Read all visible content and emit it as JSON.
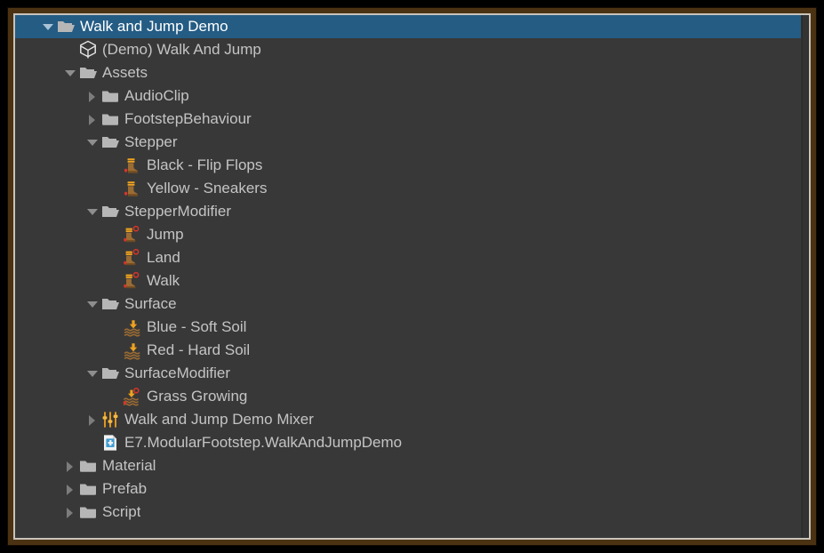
{
  "window": {
    "frame_color": "#4a3212",
    "panel_background": "#383838",
    "selection_color": "#245c84",
    "text_color": "#c4c4c4",
    "selected_text_color": "#ffffff"
  },
  "tree": {
    "rows": [
      {
        "label": "Walk and Jump Demo",
        "depth": 0,
        "twisty": "down",
        "icon": "folder-open-icon",
        "selected": true
      },
      {
        "label": "(Demo) Walk And Jump",
        "depth": 1,
        "twisty": "none",
        "icon": "unity-scene-icon",
        "selected": false
      },
      {
        "label": "Assets",
        "depth": 1,
        "twisty": "down",
        "icon": "folder-open-icon",
        "selected": false
      },
      {
        "label": "AudioClip",
        "depth": 2,
        "twisty": "right",
        "icon": "folder-closed-icon",
        "selected": false
      },
      {
        "label": "FootstepBehaviour",
        "depth": 2,
        "twisty": "right",
        "icon": "folder-closed-icon",
        "selected": false
      },
      {
        "label": "Stepper",
        "depth": 2,
        "twisty": "down",
        "icon": "folder-open-icon",
        "selected": false
      },
      {
        "label": "Black - Flip Flops",
        "depth": 3,
        "twisty": "none",
        "icon": "stepper-boot-icon",
        "selected": false
      },
      {
        "label": "Yellow - Sneakers",
        "depth": 3,
        "twisty": "none",
        "icon": "stepper-boot-icon",
        "selected": false
      },
      {
        "label": "StepperModifier",
        "depth": 2,
        "twisty": "down",
        "icon": "folder-open-icon",
        "selected": false
      },
      {
        "label": "Jump",
        "depth": 3,
        "twisty": "none",
        "icon": "stepper-modifier-icon",
        "selected": false
      },
      {
        "label": "Land",
        "depth": 3,
        "twisty": "none",
        "icon": "stepper-modifier-icon",
        "selected": false
      },
      {
        "label": "Walk",
        "depth": 3,
        "twisty": "none",
        "icon": "stepper-modifier-icon",
        "selected": false
      },
      {
        "label": "Surface",
        "depth": 2,
        "twisty": "down",
        "icon": "folder-open-icon",
        "selected": false
      },
      {
        "label": "Blue - Soft Soil",
        "depth": 3,
        "twisty": "none",
        "icon": "surface-icon",
        "selected": false
      },
      {
        "label": "Red - Hard Soil",
        "depth": 3,
        "twisty": "none",
        "icon": "surface-icon",
        "selected": false
      },
      {
        "label": "SurfaceModifier",
        "depth": 2,
        "twisty": "down",
        "icon": "folder-open-icon",
        "selected": false
      },
      {
        "label": "Grass Growing",
        "depth": 3,
        "twisty": "none",
        "icon": "surface-modifier-icon",
        "selected": false
      },
      {
        "label": "Walk and Jump Demo Mixer",
        "depth": 2,
        "twisty": "right",
        "icon": "audio-mixer-icon",
        "selected": false
      },
      {
        "label": "E7.ModularFootstep.WalkAndJumpDemo",
        "depth": 2,
        "twisty": "none",
        "icon": "assembly-definition-icon",
        "selected": false
      },
      {
        "label": "Material",
        "depth": 1,
        "twisty": "right",
        "icon": "folder-closed-icon",
        "selected": false
      },
      {
        "label": "Prefab",
        "depth": 1,
        "twisty": "right",
        "icon": "folder-closed-icon",
        "selected": false
      },
      {
        "label": "Script",
        "depth": 1,
        "twisty": "right",
        "icon": "folder-closed-icon",
        "selected": false
      }
    ]
  }
}
